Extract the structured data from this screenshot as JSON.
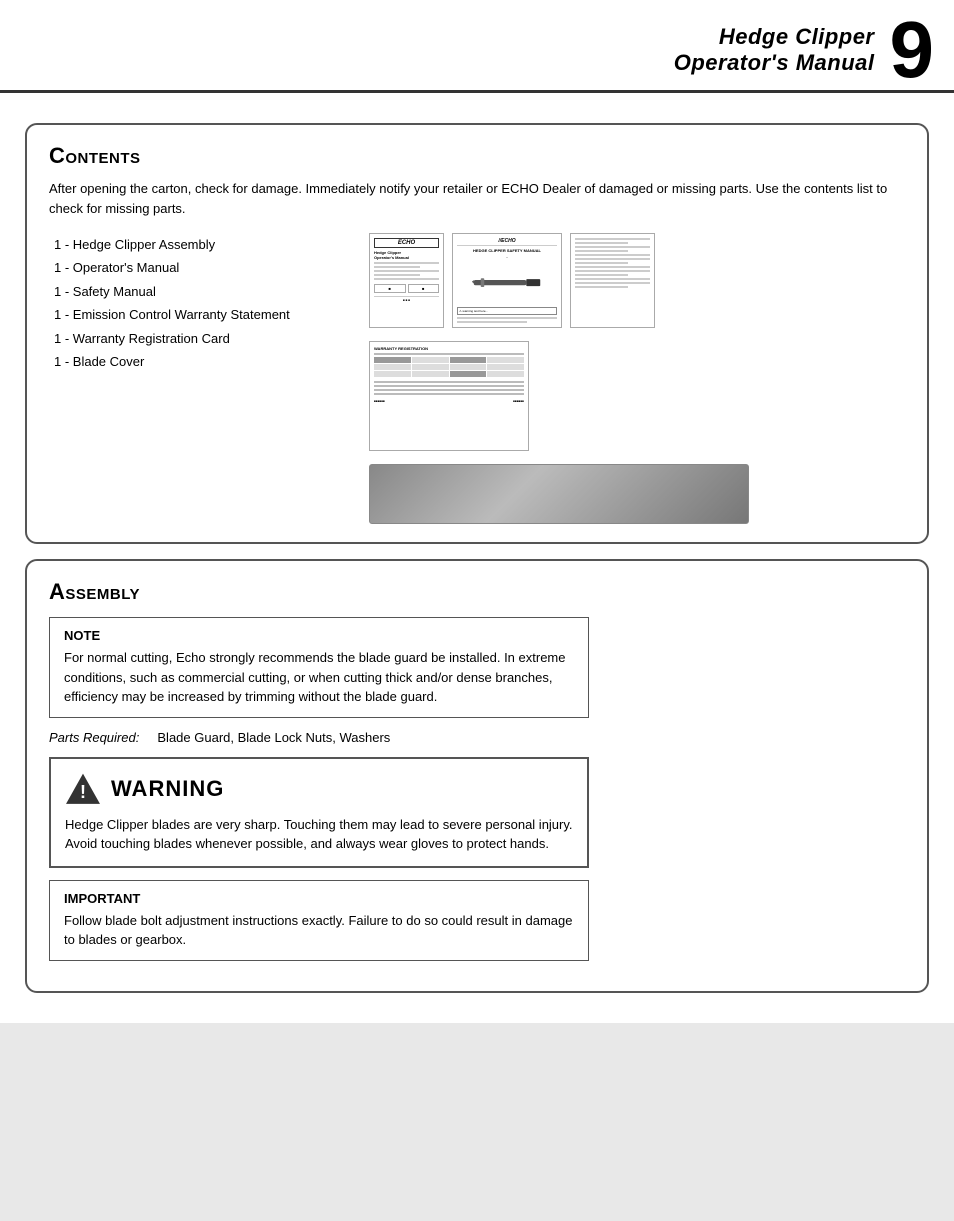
{
  "header": {
    "title_line1": "Hedge Clipper",
    "title_line2": "Operator's Manual",
    "page_number": "9"
  },
  "contents_section": {
    "title": "Contents",
    "intro": "After opening the carton, check for damage.  Immediately notify your retailer or ECHO Dealer of damaged or missing parts.  Use the contents list to check for missing parts.",
    "items": [
      "1 -   Hedge Clipper Assembly",
      "1 -   Operator's Manual",
      "1 -   Safety Manual",
      "1 -   Emission Control Warranty Statement",
      "1 -   Warranty Registration Card",
      "1 -   Blade Cover"
    ]
  },
  "assembly_section": {
    "title": "Assembly",
    "note": {
      "title": "NOTE",
      "text": "For normal cutting, Echo strongly recommends the blade guard be installed. In extreme conditions, such as commercial cutting, or when cutting thick and/or dense branches, efficiency may be increased by trimming without the blade guard."
    },
    "parts_required_label": "Parts Required:",
    "parts_required_value": "Blade Guard, Blade Lock Nuts, Washers",
    "warning": {
      "title": "WARNING",
      "text": "Hedge Clipper blades are very sharp.  Touching them may lead to severe personal injury.  Avoid touching blades whenever possible, and always wear gloves to protect hands."
    },
    "important": {
      "title": "IMPORTANT",
      "text": "Follow blade bolt adjustment instructions exactly. Failure to do so could result in damage to blades or gearbox."
    }
  },
  "icons": {
    "warning_triangle": "⚠"
  }
}
